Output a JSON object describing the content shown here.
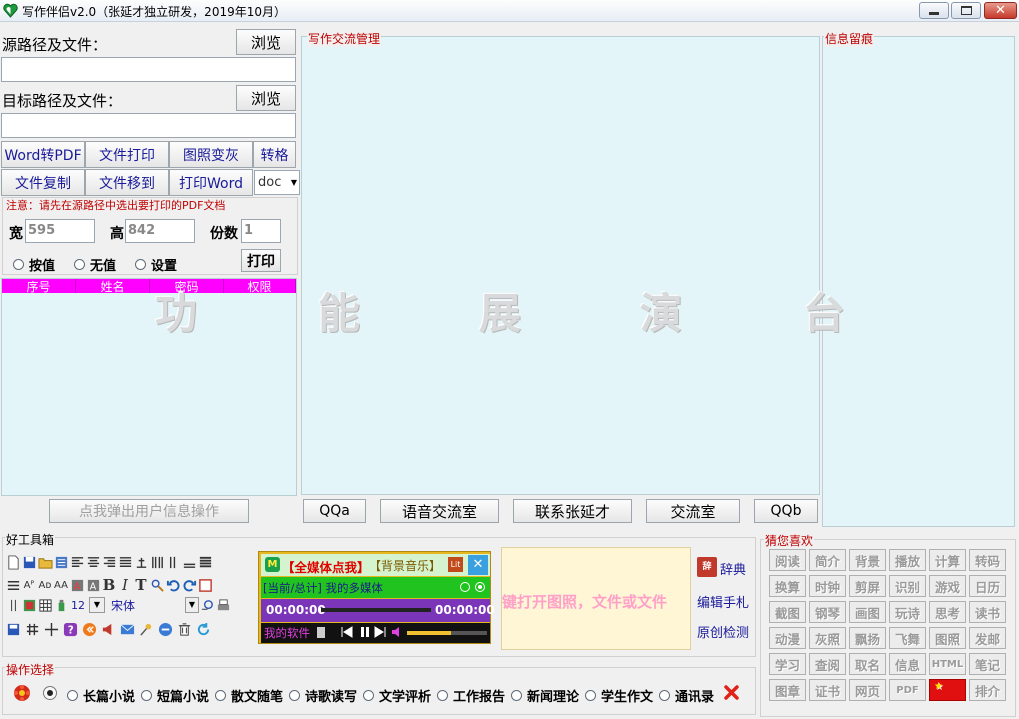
{
  "window": {
    "title": "写作伴侣v2.0（张延才独立研发，2019年10月）"
  },
  "source": {
    "label": "源路径及文件：",
    "browse": "浏览",
    "value": ""
  },
  "target": {
    "label": "目标路径及文件：",
    "browse": "浏览",
    "value": ""
  },
  "tools_row1": [
    "Word转PDF",
    "文件打印",
    "图照变灰",
    "转格"
  ],
  "tools_row2": [
    "文件复制",
    "文件移到",
    "打印Word"
  ],
  "format_select": {
    "value": "doc"
  },
  "print": {
    "note": "注意：请先在源路径中选出要打印的PDF文档",
    "width_label": "宽",
    "width_value": "595",
    "height_label": "高",
    "height_value": "842",
    "copies_label": "份数",
    "copies_value": "1",
    "radios": [
      "按值",
      "无值",
      "设置"
    ],
    "print_button": "打印"
  },
  "user_table": {
    "headers": [
      "序号",
      "姓名",
      "密码",
      "权限"
    ],
    "popup_button": "点我弹出用户信息操作"
  },
  "exchange": {
    "legend": "写作交流管理",
    "buttons": [
      "QQa",
      "语音交流室",
      "联系张延才",
      "交流室",
      "QQb"
    ]
  },
  "message": {
    "legend": "信息留痕"
  },
  "watermark": [
    "功",
    "能",
    "展",
    "演",
    "台"
  ],
  "toolbox": {
    "legend": "好工具箱",
    "font_size": "12",
    "font_name": "宋体"
  },
  "player": {
    "title1": "【全媒体点我】",
    "title2": "【背景音乐】",
    "counter": "[当前/总计] 我的多媒体",
    "time_left": "00:00:00",
    "time_right": "00:00:00",
    "my_software": "我的软件",
    "progress": 0.0,
    "volume": 0.55
  },
  "marquee": {
    "text": "键打开图照，文件或文件"
  },
  "side_links": [
    "辞典",
    "编辑手札",
    "原创检测"
  ],
  "guess": {
    "legend": "猜您喜欢",
    "rows": [
      [
        "阅读",
        "简介",
        "背景",
        "播放",
        "计算",
        "转码"
      ],
      [
        "换算",
        "时钟",
        "剪屏",
        "识别",
        "游戏",
        "日历"
      ],
      [
        "截图",
        "钢琴",
        "画图",
        "玩诗",
        "思考",
        "读书"
      ],
      [
        "动漫",
        "灰照",
        "飘扬",
        "飞舞",
        "图照",
        "发邮"
      ],
      [
        "学习",
        "查阅",
        "取名",
        "信息",
        "HTML",
        "笔记"
      ],
      [
        "图章",
        "证书",
        "网页",
        "PDF",
        "",
        "排介"
      ]
    ]
  },
  "operation": {
    "legend": "操作选择",
    "options": [
      "长篇小说",
      "短篇小说",
      "散文随笔",
      "诗歌读写",
      "文学评析",
      "工作报告",
      "新闻理论",
      "学生作文",
      "通讯录"
    ]
  },
  "colors": {
    "accent_magenta": "#ff00ff",
    "panel_bg": "#e3f5f8",
    "legend_red": "#c00000"
  }
}
